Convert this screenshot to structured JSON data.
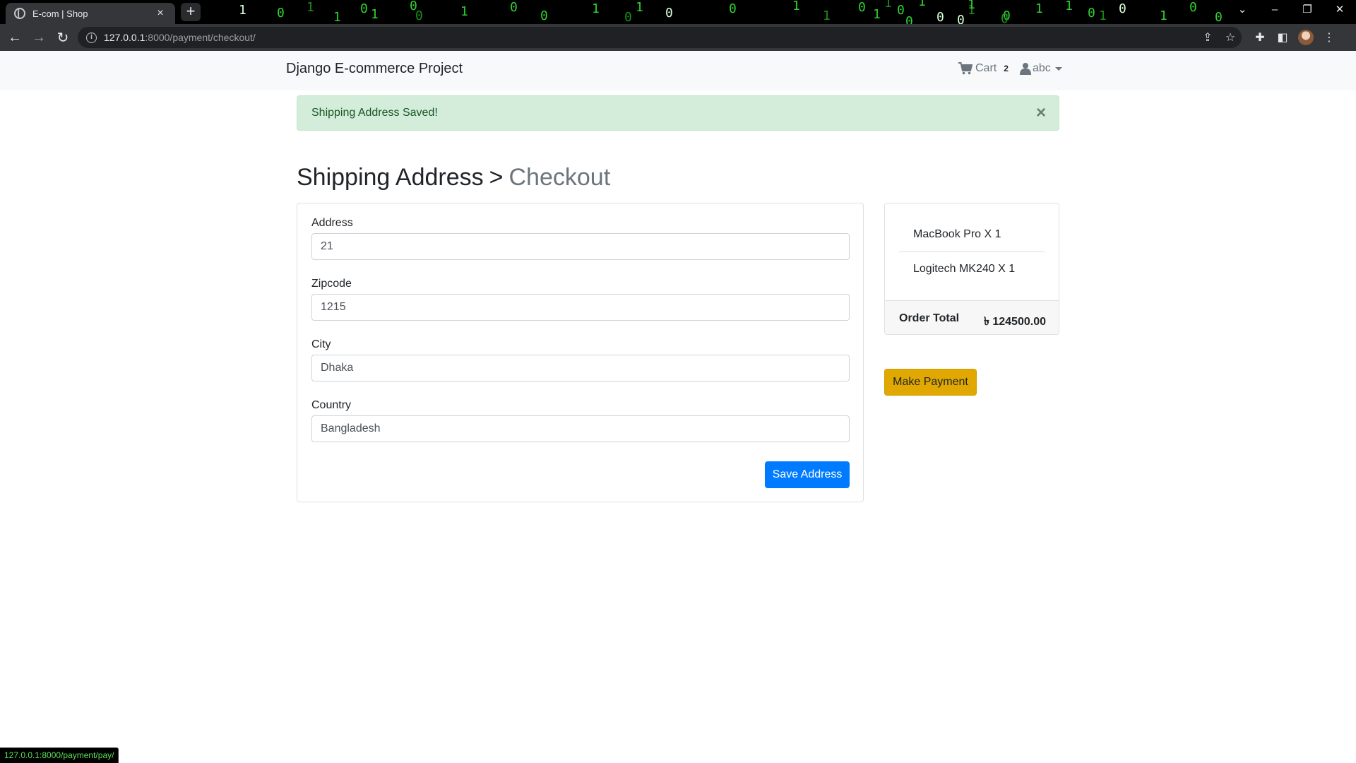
{
  "browser": {
    "tab_title": "E-com | Shop",
    "tab_close": "×",
    "new_tab": "+",
    "url_host": "127.0.0.1",
    "url_path": ":8000/payment/checkout/",
    "status_url": "127.0.0.1:8000/payment/pay/",
    "theme_digits": [
      "1",
      "0",
      "1",
      "1",
      "0",
      "1",
      "0",
      "0",
      "1",
      "0",
      "0",
      "1",
      "0",
      "1",
      "0",
      "0",
      "1",
      "1",
      "0",
      "1",
      "0",
      "0",
      "1",
      "0",
      "1",
      "1",
      "0",
      "1",
      "0",
      "1",
      "0",
      "0",
      "1",
      "0",
      "1",
      "0",
      "1",
      "0"
    ]
  },
  "navbar": {
    "brand": "Django E-commerce Project",
    "cart_label": "Cart",
    "cart_count": "2",
    "user_label": "abc"
  },
  "alert": {
    "message": "Shipping Address Saved!",
    "close": "×",
    "color": "#d4edda"
  },
  "heading": {
    "primary": "Shipping Address",
    "separator": ">",
    "secondary": "Checkout"
  },
  "address_form": {
    "fields": [
      {
        "label": "Address",
        "value": "21"
      },
      {
        "label": "Zipcode",
        "value": "1215"
      },
      {
        "label": "City",
        "value": "Dhaka"
      },
      {
        "label": "Country",
        "value": "Bangladesh"
      }
    ],
    "save_label": "Save Address"
  },
  "order_summary": {
    "items": [
      {
        "text": "MacBook Pro X 1"
      },
      {
        "text": "Logitech MK240 X 1"
      }
    ],
    "total_label": "Order Total",
    "total_value": "৳ 124500.00"
  },
  "payment": {
    "pay_label": "Make Payment"
  },
  "colors": {
    "primary": "#007bff",
    "warning": "#e0a800",
    "success_text": "#155724",
    "matrix_green": "#2fd12f"
  }
}
